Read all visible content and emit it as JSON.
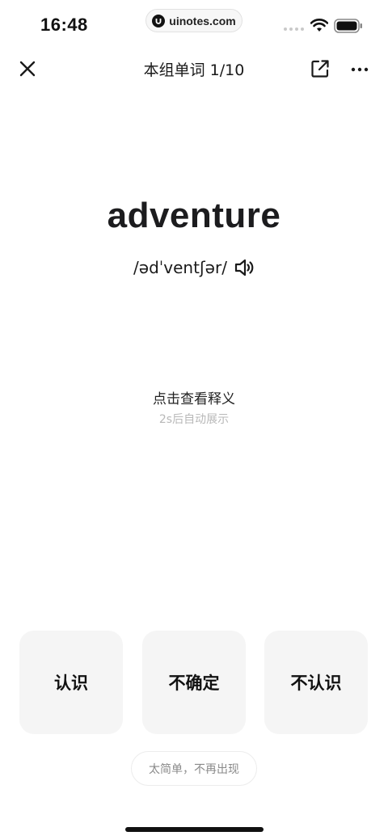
{
  "status_bar": {
    "time": "16:48",
    "watermark": "uinotes.com",
    "icons": [
      "signal-dots-icon",
      "wifi-icon",
      "battery-icon"
    ]
  },
  "nav": {
    "title": "本组单词 1/10",
    "icons": [
      "close-icon",
      "share-icon",
      "more-icon"
    ]
  },
  "card": {
    "word": "adventure",
    "phonetic": "/ədˈventʃər/",
    "speaker_icon": "speaker-icon",
    "reveal_hint": "点击查看释义",
    "auto_hint": "2s后自动展示"
  },
  "answers": {
    "know": "认识",
    "unsure": "不确定",
    "dont_know": "不认识"
  },
  "too_easy_label": "太简单，不再出现",
  "colors": {
    "background": "#ffffff",
    "button_bg": "#f5f5f5",
    "hint_gray": "#b8b8b8",
    "text": "#1a1a1a"
  }
}
